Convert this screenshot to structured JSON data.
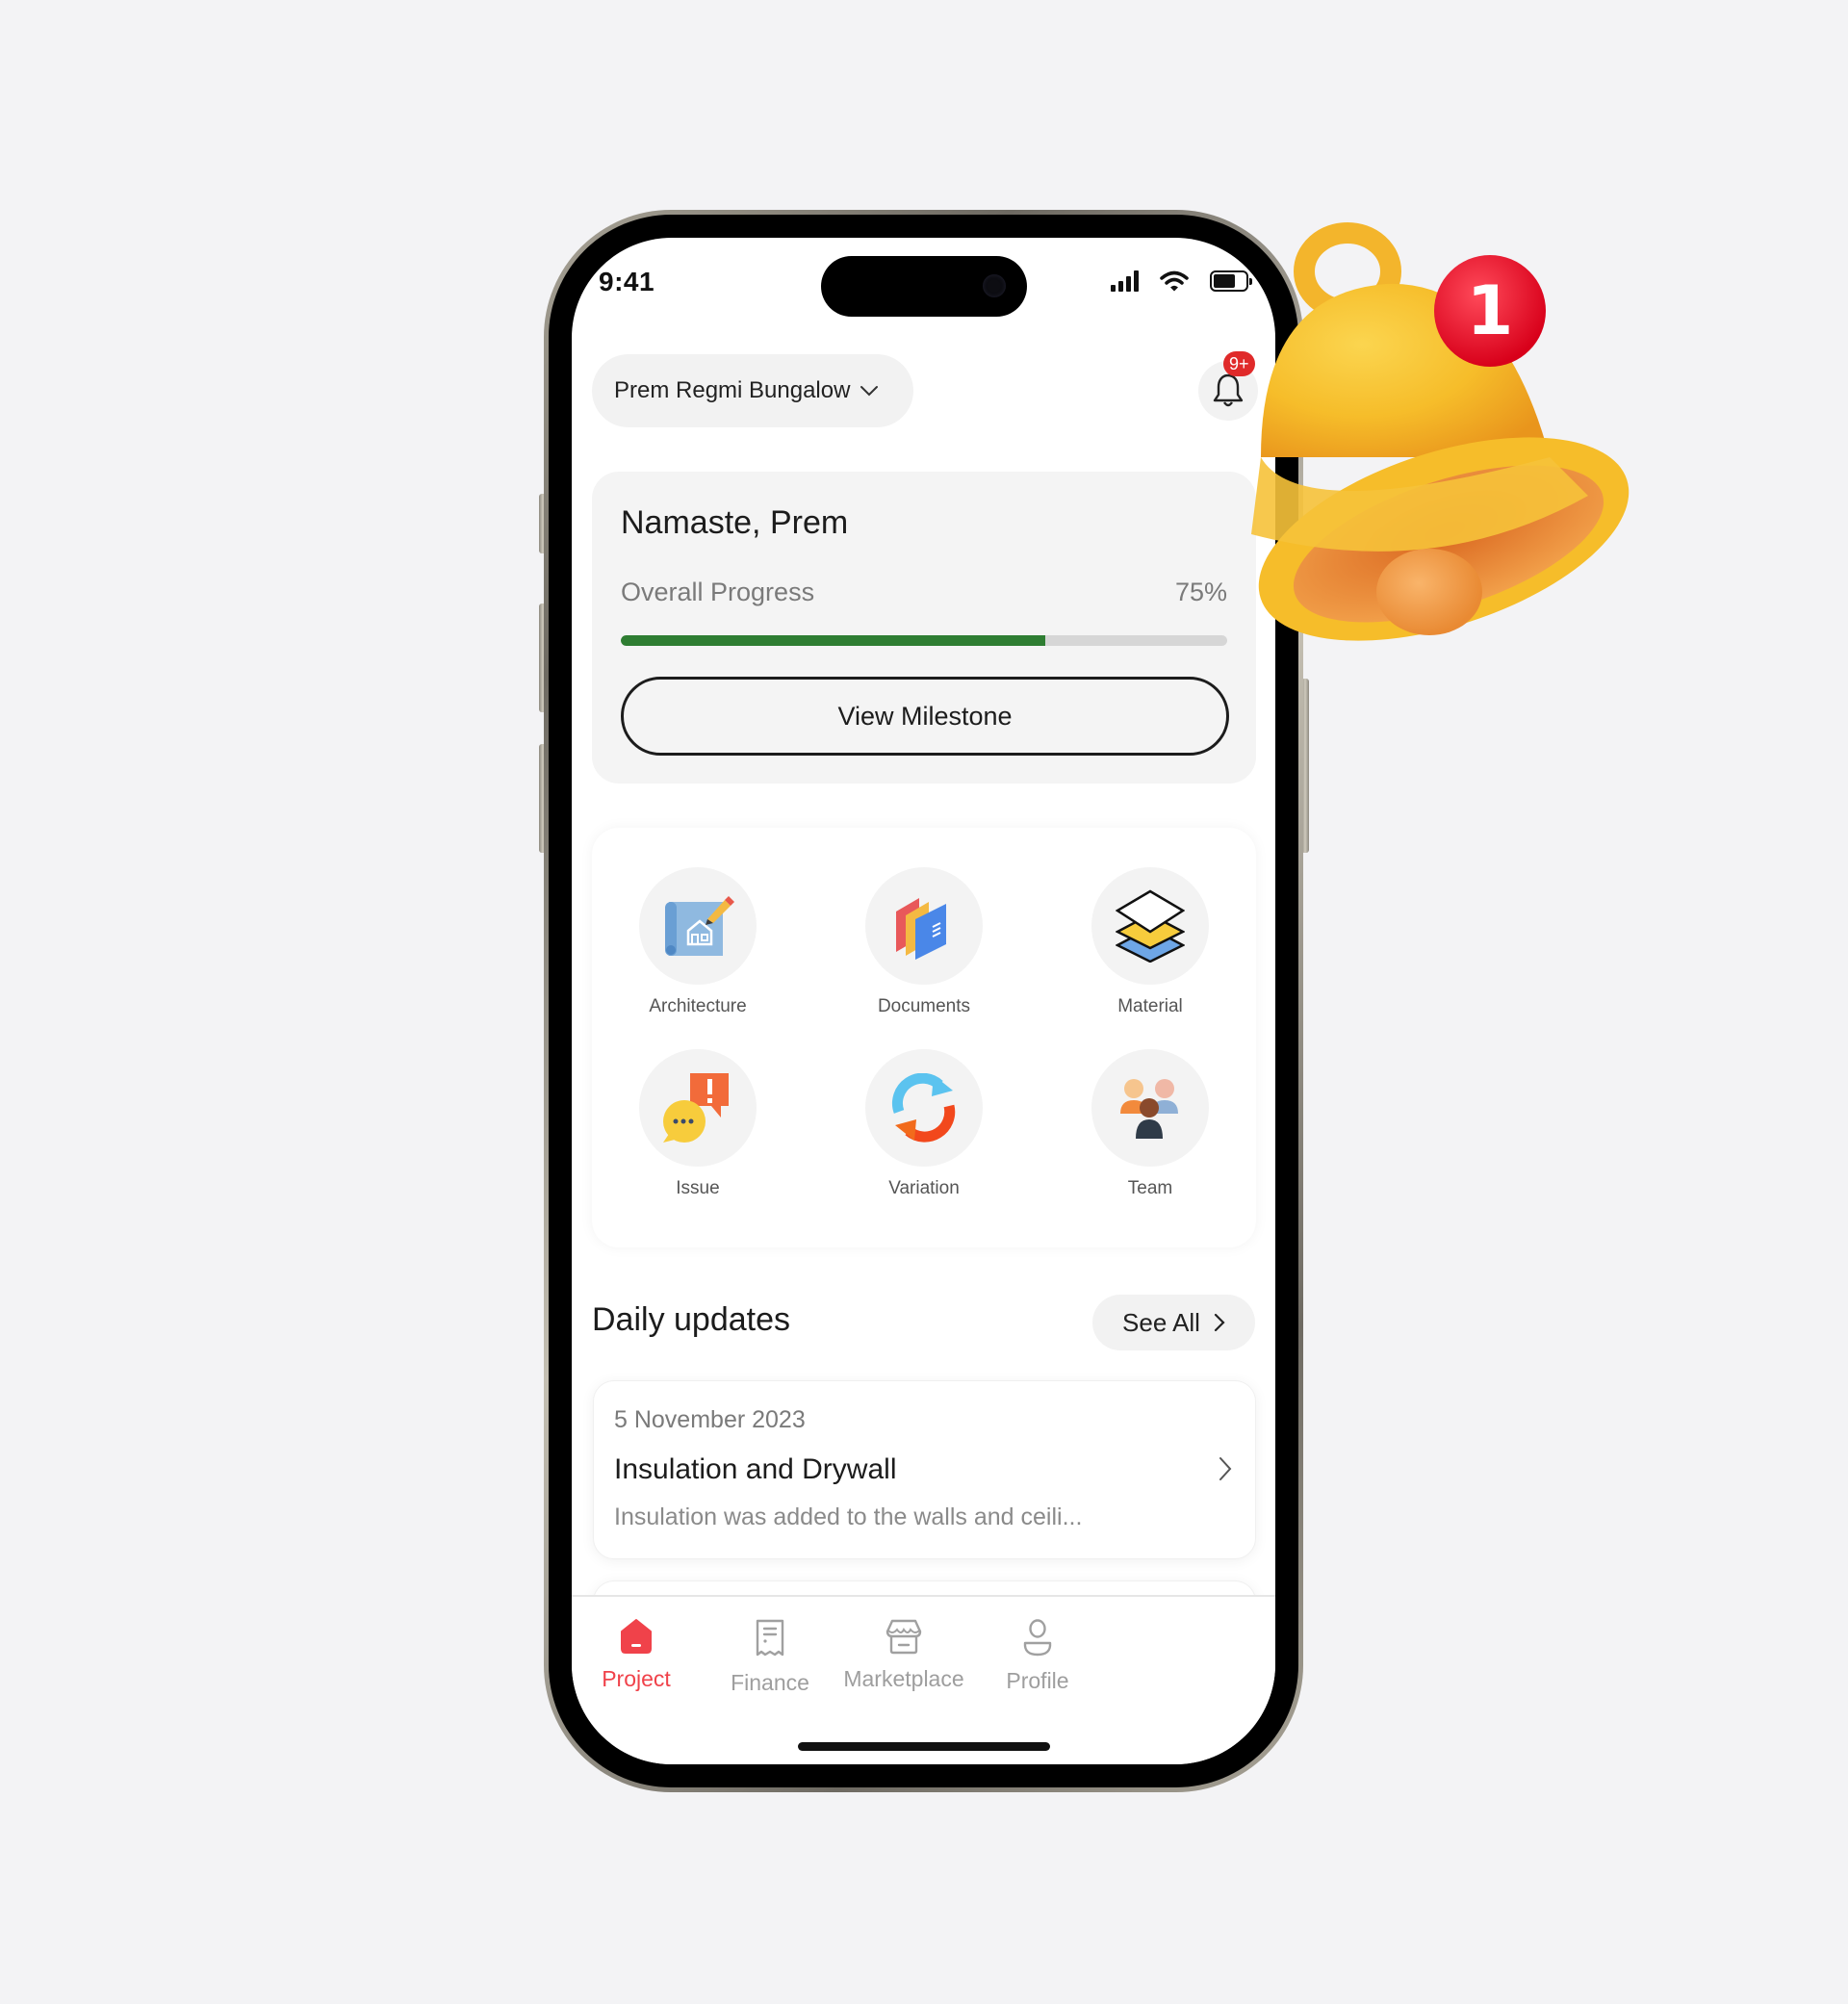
{
  "status_bar": {
    "time": "9:41"
  },
  "header": {
    "project_name": "Prem Regmi Bungalow",
    "project_chevron": "chevron-down-icon",
    "notification_badge": "9+"
  },
  "progress_card": {
    "greeting": "Namaste, Prem",
    "progress_label": "Overall Progress",
    "progress_value_text": "75%",
    "progress_percent": 70,
    "progress_color": "#2e7d32",
    "button_label": "View Milestone"
  },
  "quick_actions": [
    {
      "label": "Architecture",
      "icon": "blueprint-icon"
    },
    {
      "label": "Documents",
      "icon": "folders-icon"
    },
    {
      "label": "Material",
      "icon": "layers-icon"
    },
    {
      "label": "Issue",
      "icon": "chat-alert-icon"
    },
    {
      "label": "Variation",
      "icon": "refresh-arrows-icon"
    },
    {
      "label": "Team",
      "icon": "team-icon"
    }
  ],
  "daily_updates": {
    "title": "Daily updates",
    "see_all_label": "See All",
    "items": [
      {
        "date": "5 November 2023",
        "title": "Insulation and Drywall",
        "description": "Insulation was added to the walls and ceili..."
      }
    ]
  },
  "tab_bar": {
    "active_color": "#f0424a",
    "tabs": [
      {
        "label": "Project",
        "icon": "home-icon",
        "active": true
      },
      {
        "label": "Finance",
        "icon": "receipt-icon",
        "active": false
      },
      {
        "label": "Marketplace",
        "icon": "store-icon",
        "active": false
      },
      {
        "label": "Profile",
        "icon": "user-icon",
        "active": false
      }
    ]
  },
  "decoration": {
    "bell_badge_count": "1"
  }
}
